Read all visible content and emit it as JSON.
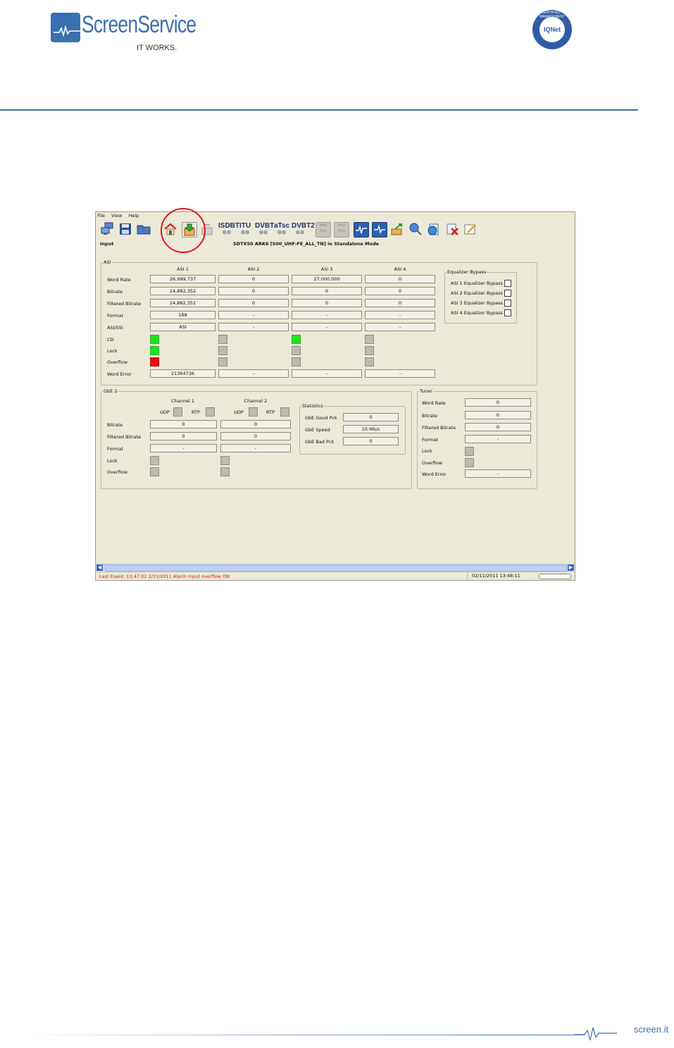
{
  "page": {
    "logo_text": "ScreenService",
    "logo_tagline": "IT WORKS.",
    "cert_text": "IQNet",
    "cert_ring_text": "CERTIFIED · MANAGEMENT SYSTEM",
    "footer_url": "screen.it",
    "brand_color": "#3a6fb0"
  },
  "app": {
    "menu": [
      "File",
      "View",
      "Help"
    ],
    "toolbar": {
      "icons": [
        "network-icon",
        "save-icon",
        "folder-icon",
        "home-icon",
        "input-icon",
        "output-icon"
      ],
      "standards": [
        {
          "label": "ISDBT",
          "sub": "⚙⚙"
        },
        {
          "label": "ITU",
          "sub": "⚙⚙"
        },
        {
          "label": "DVBT",
          "sub": "⚙⚙"
        },
        {
          "label": "aTsc",
          "sub": "⚙⚙"
        },
        {
          "label": "DVBT2",
          "sub": "⚙⚙"
        }
      ],
      "mod_labels": [
        "Mod Proc",
        "Mod Proc"
      ],
      "tools": [
        "monitor1-icon",
        "monitor2-icon",
        "export-icon",
        "search-web-icon",
        "globe-icon",
        "delete-icon",
        "edit-icon"
      ]
    },
    "mode_label": "Input",
    "window_title": "SDTX50 ARK6 [S00_UHF-FE_ALL_TN] in Standalone Mode",
    "asi": {
      "legend": "ASI",
      "columns": [
        "ASI 1",
        "ASI 2",
        "ASI 3",
        "ASI 4"
      ],
      "rows": {
        "word_rate": {
          "label": "Word Rate",
          "values": [
            "26,999,737",
            "0",
            "27,000,000",
            "0"
          ]
        },
        "bitrate": {
          "label": "Bitrate",
          "values": [
            "24,882,352",
            "0",
            "0",
            "0"
          ]
        },
        "filtered_bitrate": {
          "label": "Filtered Bitrate",
          "values": [
            "24,882,352",
            "0",
            "0",
            "0"
          ]
        },
        "format": {
          "label": "Format",
          "values": [
            "188",
            "-",
            "-",
            "-"
          ]
        },
        "asi_ssi": {
          "label": "ASI/SSI",
          "values": [
            "ASI",
            "-",
            "-",
            "-"
          ]
        },
        "cd": {
          "label": "CD",
          "states": [
            "green",
            "gray",
            "green",
            "gray"
          ]
        },
        "lock": {
          "label": "Lock",
          "states": [
            "green",
            "gray",
            "gray",
            "gray"
          ]
        },
        "overflow": {
          "label": "Overflow",
          "states": [
            "red",
            "gray",
            "gray",
            "gray"
          ]
        },
        "word_error": {
          "label": "Word Error",
          "values": [
            "21364736",
            "-",
            "-",
            "-"
          ]
        }
      },
      "equalizer": {
        "legend": "Equalizer Bypass",
        "items": [
          "ASI 1 Equalizer Bypass",
          "ASI 2 Equalizer Bypass",
          "ASI 3 Equalizer Bypass",
          "ASI 4 Equalizer Bypass"
        ]
      }
    },
    "gbe": {
      "legend": "GbE 2",
      "channels": [
        "Channel 1",
        "Channel 2"
      ],
      "udp": "UDP",
      "rtp": "RTP",
      "rows": {
        "bitrate": {
          "label": "Bitrate",
          "values": [
            "0",
            "0"
          ]
        },
        "filtered_bitrate": {
          "label": "Filtered Bitrate",
          "values": [
            "0",
            "0"
          ]
        },
        "format": {
          "label": "Format",
          "values": [
            "-",
            "-"
          ]
        },
        "lock": {
          "label": "Lock"
        },
        "overflow": {
          "label": "Overflow"
        }
      },
      "statistics": {
        "legend": "Statistics",
        "good_label": "GbE Good Pck",
        "good_value": "0",
        "speed_label": "GbE Speed",
        "speed_value": "10 Mb/s",
        "bad_label": "GbE Bad Pck",
        "bad_value": "0"
      }
    },
    "tuner": {
      "legend": "Tuner",
      "word_rate": {
        "label": "Word Rate",
        "value": "0"
      },
      "bitrate": {
        "label": "Bitrate",
        "value": "0"
      },
      "filtered_bitrate": {
        "label": "Filtered Bitrate",
        "value": "0"
      },
      "format": {
        "label": "Format",
        "value": "-"
      },
      "lock": {
        "label": "Lock"
      },
      "overflow": {
        "label": "Overflow"
      },
      "word_error": {
        "label": "Word Error",
        "value": "-"
      }
    },
    "status": {
      "last_event": "Last Event: 13.47.02 2/11/2011 Alarm  Input overflow ON",
      "timestamp": "02/11/2011 13:48:11"
    }
  }
}
